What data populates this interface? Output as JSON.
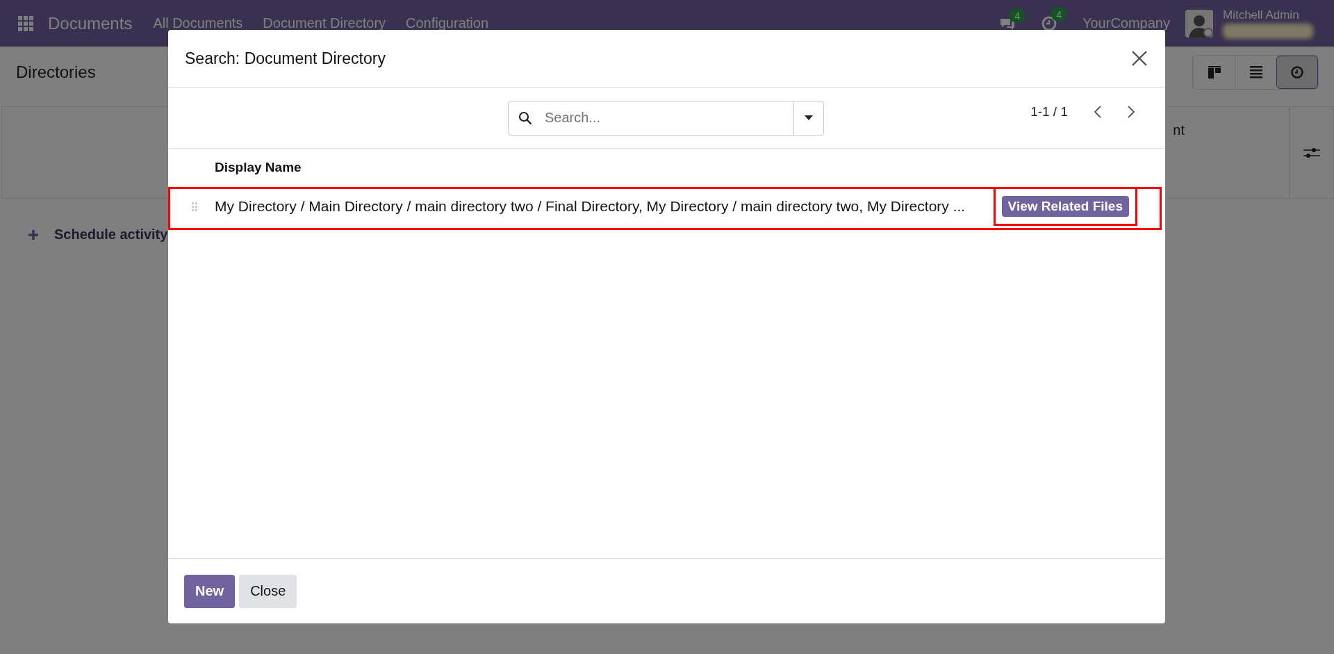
{
  "navbar": {
    "app_name": "Documents",
    "menu": [
      "All Documents",
      "Document Directory",
      "Configuration"
    ],
    "messages_count": "4",
    "activities_count": "4",
    "company": "YourCompany",
    "user_name": "Mitchell Admin"
  },
  "page": {
    "title": "Directories",
    "views": [
      {
        "kind": "kanban",
        "selected": false
      },
      {
        "kind": "list",
        "selected": false
      },
      {
        "kind": "activity",
        "selected": true
      }
    ],
    "column_3": "nt",
    "schedule_activity": "Schedule activity"
  },
  "dialog": {
    "title": "Search: Document Directory",
    "search": {
      "placeholder": "Search..."
    },
    "pager": "1-1 / 1",
    "columns": [
      "Display Name"
    ],
    "rows": [
      {
        "display_name": "My Directory / Main Directory / main directory two / Final Directory, My Directory / main directory two, My Directory ...",
        "action": "View Related Files",
        "highlighted": true,
        "action_highlighted": true
      }
    ],
    "buttons": [
      {
        "label": "New",
        "kind": "primary"
      },
      {
        "label": "Close",
        "kind": "secondary"
      }
    ]
  }
}
